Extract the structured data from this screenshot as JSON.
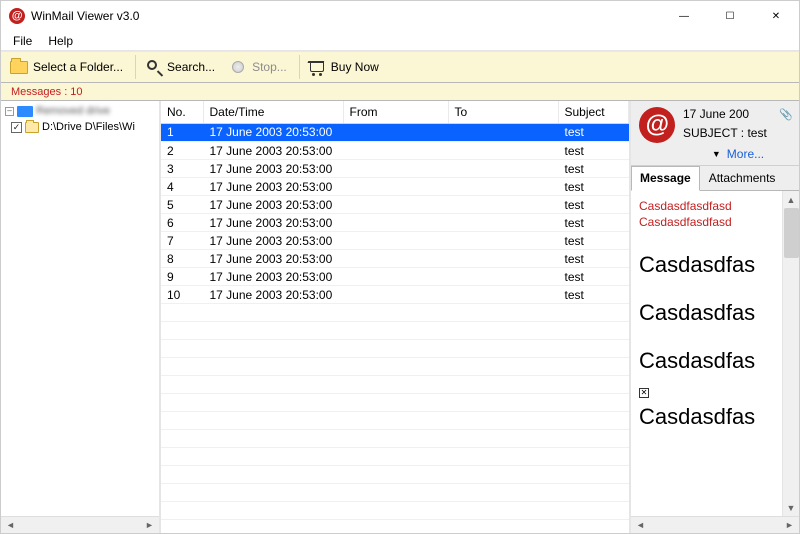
{
  "app": {
    "title": "WinMail Viewer v3.0"
  },
  "window": {
    "min": "—",
    "max": "☐",
    "close": "✕"
  },
  "menu": {
    "file": "File",
    "help": "Help"
  },
  "toolbar": {
    "select_folder": "Select a Folder...",
    "search": "Search...",
    "stop": "Stop...",
    "buy": "Buy Now"
  },
  "status": {
    "messages_label": "Messages : 10"
  },
  "tree": {
    "root_label": "Removed drive",
    "child_checked": "✓",
    "child_label": "D:\\Drive D\\Files\\Wi"
  },
  "table": {
    "cols": {
      "no": "No.",
      "datetime": "Date/Time",
      "from": "From",
      "to": "To",
      "subject": "Subject"
    },
    "rows": [
      {
        "no": "1",
        "datetime": "17 June 2003 20:53:00",
        "from": "",
        "to": "",
        "subject": "test"
      },
      {
        "no": "2",
        "datetime": "17 June 2003 20:53:00",
        "from": "",
        "to": "",
        "subject": "test"
      },
      {
        "no": "3",
        "datetime": "17 June 2003 20:53:00",
        "from": "",
        "to": "",
        "subject": "test"
      },
      {
        "no": "4",
        "datetime": "17 June 2003 20:53:00",
        "from": "",
        "to": "",
        "subject": "test"
      },
      {
        "no": "5",
        "datetime": "17 June 2003 20:53:00",
        "from": "",
        "to": "",
        "subject": "test"
      },
      {
        "no": "6",
        "datetime": "17 June 2003 20:53:00",
        "from": "",
        "to": "",
        "subject": "test"
      },
      {
        "no": "7",
        "datetime": "17 June 2003 20:53:00",
        "from": "",
        "to": "",
        "subject": "test"
      },
      {
        "no": "8",
        "datetime": "17 June 2003 20:53:00",
        "from": "",
        "to": "",
        "subject": "test"
      },
      {
        "no": "9",
        "datetime": "17 June 2003 20:53:00",
        "from": "",
        "to": "",
        "subject": "test"
      },
      {
        "no": "10",
        "datetime": "17 June 2003 20:53:00",
        "from": "",
        "to": "",
        "subject": "test"
      }
    ],
    "selected_index": 0
  },
  "preview": {
    "date": "17 June 200",
    "subject": "SUBJECT : test",
    "more": "More...",
    "tabs": {
      "message": "Message",
      "attachments": "Attachments"
    },
    "body": {
      "small1": "Casdasdfasdfasd",
      "small2": "Casdasdfasdfasd",
      "big1": "Casdasdfas",
      "big2": "Casdasdfas",
      "big3": "Casdasdfas",
      "big4": "Casdasdfas"
    }
  },
  "scroll": {
    "left": "◄",
    "right": "►",
    "up": "▲",
    "down": "▼"
  }
}
